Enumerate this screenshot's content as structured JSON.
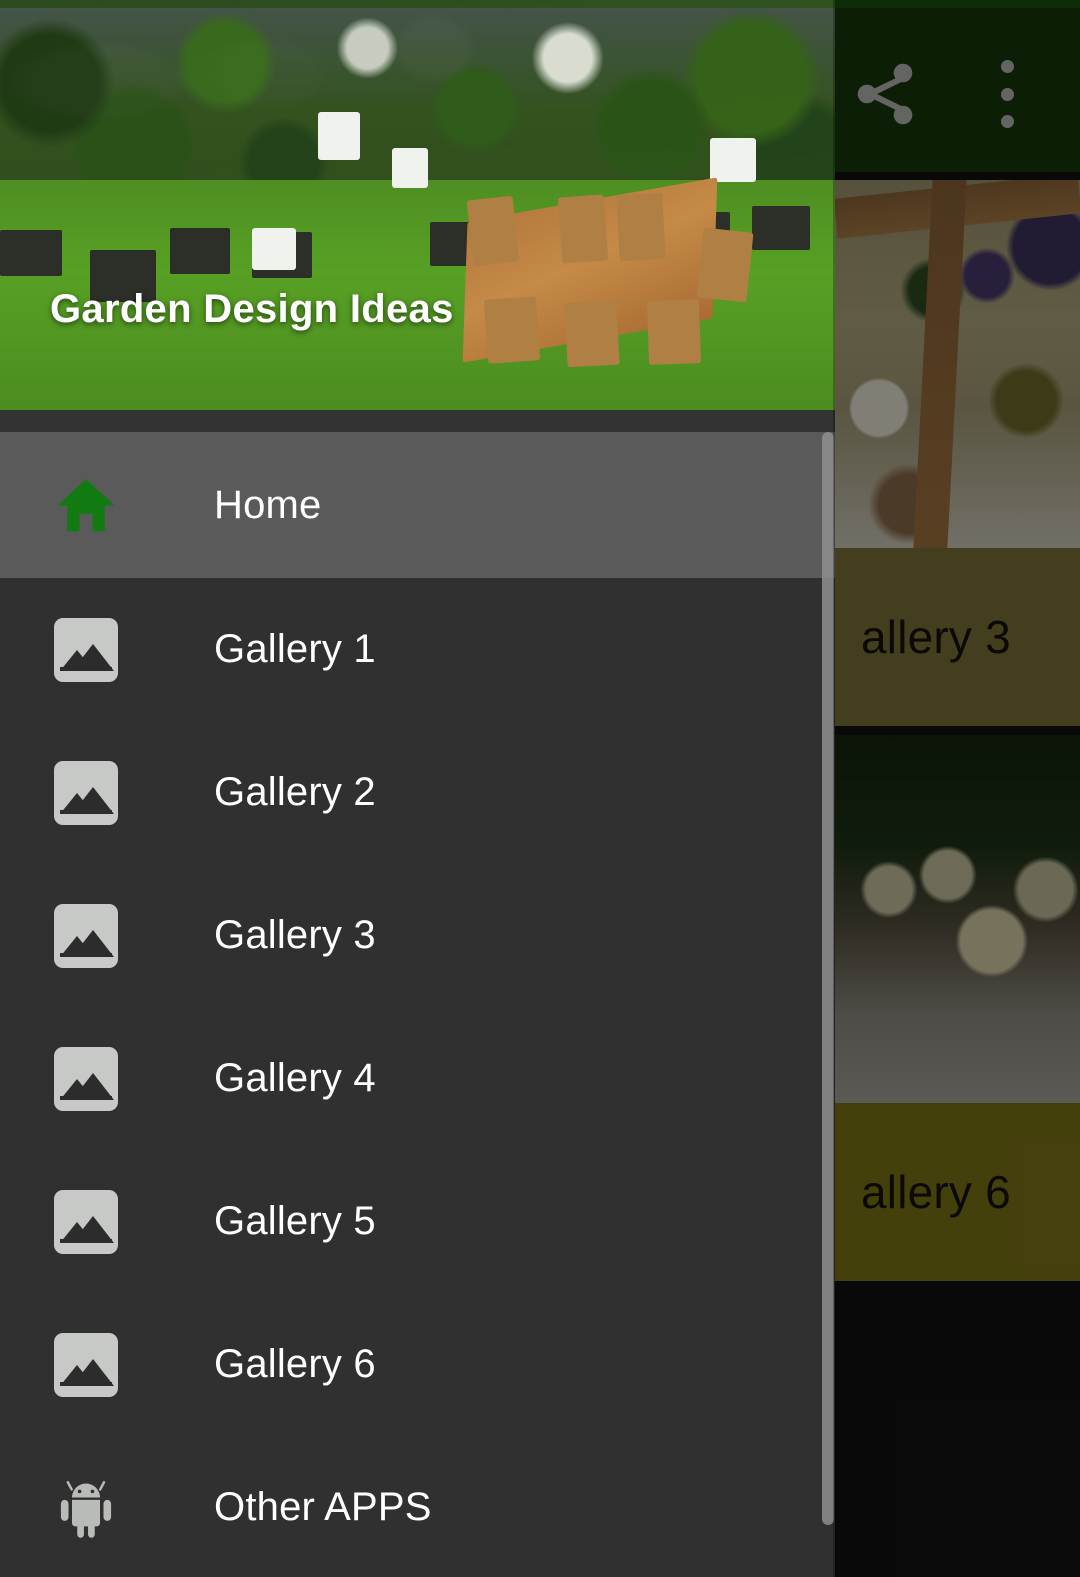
{
  "app": {
    "title": "Garden Design Ideas",
    "appbar_color": "#16380A",
    "status_bar_color": "#14500D",
    "accent_color": "#0B7A0B"
  },
  "appbar": {
    "share_icon": "share-icon",
    "overflow_icon": "more-vertical-icon"
  },
  "drawer": {
    "header_title": "Garden Design Ideas",
    "selected_item": "Home",
    "items": [
      {
        "label": "Home",
        "icon": "home-icon",
        "selected": true
      },
      {
        "label": "Gallery 1",
        "icon": "image-icon",
        "selected": false
      },
      {
        "label": "Gallery 2",
        "icon": "image-icon",
        "selected": false
      },
      {
        "label": "Gallery 3",
        "icon": "image-icon",
        "selected": false
      },
      {
        "label": "Gallery 4",
        "icon": "image-icon",
        "selected": false
      },
      {
        "label": "Gallery 5",
        "icon": "image-icon",
        "selected": false
      },
      {
        "label": "Gallery 6",
        "icon": "image-icon",
        "selected": false
      },
      {
        "label": "Other APPS",
        "icon": "android-icon",
        "selected": false
      }
    ]
  },
  "content": {
    "cards": [
      {
        "caption": "allery 3",
        "caption_color": "#7A7438"
      },
      {
        "caption": "allery 6",
        "caption_color": "#7D7517"
      }
    ]
  }
}
